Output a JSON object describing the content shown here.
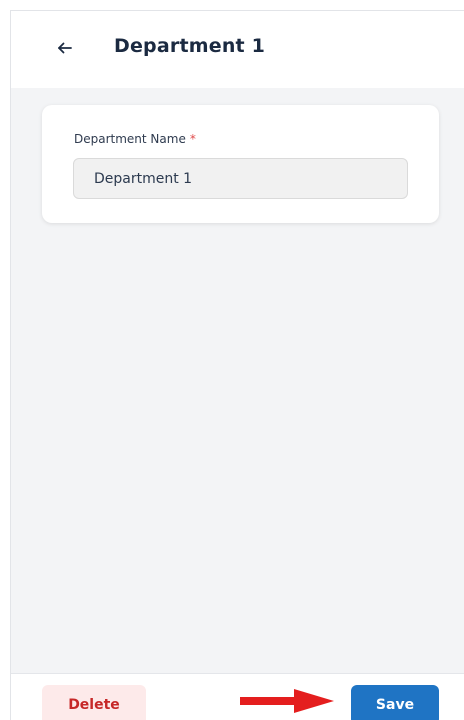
{
  "header": {
    "back_icon": "arrow-left-icon",
    "title": "Department 1"
  },
  "form": {
    "label": "Department Name",
    "required_mark": "*",
    "value": "Department 1"
  },
  "footer": {
    "delete_label": "Delete",
    "save_label": "Save"
  },
  "colors": {
    "accent": "#1f74c4",
    "danger": "#c62828",
    "danger_bg": "#fdeaea",
    "annotation": "#e41e1e",
    "background": "#f3f4f6"
  }
}
